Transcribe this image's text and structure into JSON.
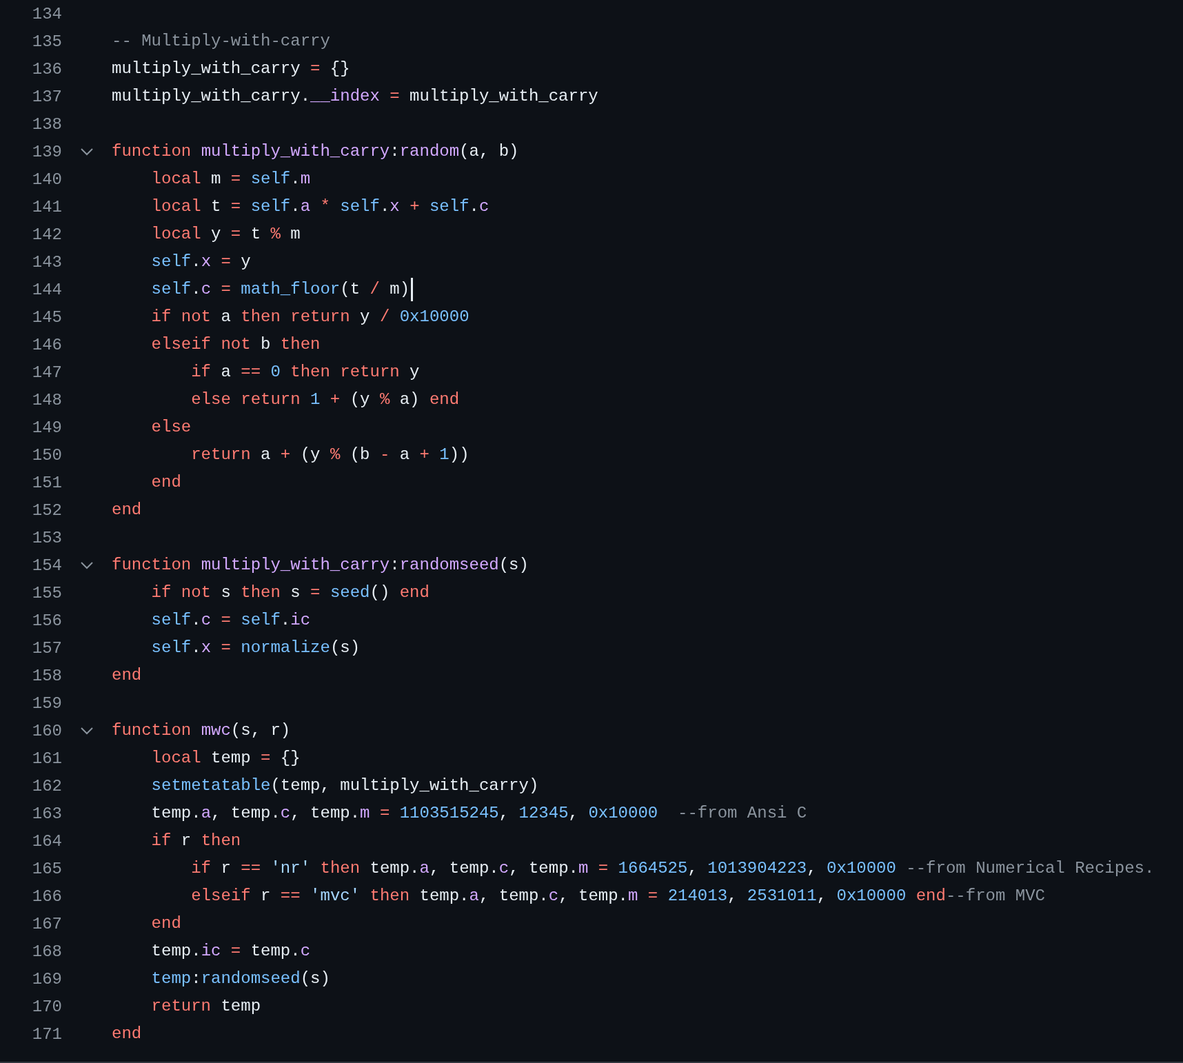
{
  "lines": [
    {
      "number": "134"
    },
    {
      "number": "135",
      "tokens": [
        {
          "text": "-- Multiply-with-carry",
          "kind": "comment"
        }
      ]
    },
    {
      "number": "136",
      "tokens": [
        {
          "text": "multiply_with_carry ",
          "kind": "plain"
        },
        {
          "text": "=",
          "kind": "keyword"
        },
        {
          "text": " {}",
          "kind": "plain"
        }
      ]
    },
    {
      "number": "137",
      "tokens": [
        {
          "text": "multiply_with_carry.",
          "kind": "plain"
        },
        {
          "text": "__index ",
          "kind": "func"
        },
        {
          "text": "=",
          "kind": "keyword"
        },
        {
          "text": " multiply_with_carry",
          "kind": "plain"
        }
      ]
    },
    {
      "number": "138"
    },
    {
      "number": "139",
      "expanded": true,
      "tokens": [
        {
          "text": "function ",
          "kind": "keyword"
        },
        {
          "text": "multiply_with_carry",
          "kind": "func"
        },
        {
          "text": ":",
          "kind": "plain"
        },
        {
          "text": "random",
          "kind": "func"
        },
        {
          "text": "(a, b)",
          "kind": "plain"
        }
      ]
    },
    {
      "number": "140",
      "tokens": [
        {
          "text": "    local",
          "kind": "keyword"
        },
        {
          "text": " m ",
          "kind": "plain"
        },
        {
          "text": "= ",
          "kind": "keyword"
        },
        {
          "text": "self",
          "kind": "const"
        },
        {
          "text": ".",
          "kind": "plain"
        },
        {
          "text": "m",
          "kind": "func"
        }
      ]
    },
    {
      "number": "141",
      "tokens": [
        {
          "text": "    local",
          "kind": "keyword"
        },
        {
          "text": " t ",
          "kind": "plain"
        },
        {
          "text": "= ",
          "kind": "keyword"
        },
        {
          "text": "self",
          "kind": "const"
        },
        {
          "text": ".",
          "kind": "plain"
        },
        {
          "text": "a ",
          "kind": "func"
        },
        {
          "text": "* ",
          "kind": "keyword"
        },
        {
          "text": "self",
          "kind": "const"
        },
        {
          "text": ".",
          "kind": "plain"
        },
        {
          "text": "x ",
          "kind": "func"
        },
        {
          "text": "+ ",
          "kind": "keyword"
        },
        {
          "text": "self",
          "kind": "const"
        },
        {
          "text": ".",
          "kind": "plain"
        },
        {
          "text": "c",
          "kind": "func"
        }
      ]
    },
    {
      "number": "142",
      "tokens": [
        {
          "text": "    local",
          "kind": "keyword"
        },
        {
          "text": " y ",
          "kind": "plain"
        },
        {
          "text": "=",
          "kind": "keyword"
        },
        {
          "text": " t ",
          "kind": "plain"
        },
        {
          "text": "%",
          "kind": "keyword"
        },
        {
          "text": " m",
          "kind": "plain"
        }
      ]
    },
    {
      "number": "143",
      "tokens": [
        {
          "text": "    self",
          "kind": "const"
        },
        {
          "text": ".",
          "kind": "plain"
        },
        {
          "text": "x ",
          "kind": "func"
        },
        {
          "text": "=",
          "kind": "keyword"
        },
        {
          "text": " y",
          "kind": "plain"
        }
      ]
    },
    {
      "number": "144",
      "cursor": true,
      "tokens": [
        {
          "text": "    self",
          "kind": "const"
        },
        {
          "text": ".",
          "kind": "plain"
        },
        {
          "text": "c ",
          "kind": "func"
        },
        {
          "text": "= ",
          "kind": "keyword"
        },
        {
          "text": "math_floor",
          "kind": "const"
        },
        {
          "text": "(t ",
          "kind": "plain"
        },
        {
          "text": "/",
          "kind": "keyword"
        },
        {
          "text": " m)",
          "kind": "plain"
        }
      ]
    },
    {
      "number": "145",
      "tokens": [
        {
          "text": "    if not",
          "kind": "keyword"
        },
        {
          "text": " a ",
          "kind": "plain"
        },
        {
          "text": "then return",
          "kind": "keyword"
        },
        {
          "text": " y ",
          "kind": "plain"
        },
        {
          "text": "/ ",
          "kind": "keyword"
        },
        {
          "text": "0x10000",
          "kind": "const"
        }
      ]
    },
    {
      "number": "146",
      "tokens": [
        {
          "text": "    elseif not",
          "kind": "keyword"
        },
        {
          "text": " b ",
          "kind": "plain"
        },
        {
          "text": "then",
          "kind": "keyword"
        }
      ]
    },
    {
      "number": "147",
      "tokens": [
        {
          "text": "        if",
          "kind": "keyword"
        },
        {
          "text": " a ",
          "kind": "plain"
        },
        {
          "text": "== ",
          "kind": "keyword"
        },
        {
          "text": "0 ",
          "kind": "const"
        },
        {
          "text": "then return",
          "kind": "keyword"
        },
        {
          "text": " y",
          "kind": "plain"
        }
      ]
    },
    {
      "number": "148",
      "tokens": [
        {
          "text": "        else return ",
          "kind": "keyword"
        },
        {
          "text": "1 ",
          "kind": "const"
        },
        {
          "text": "+",
          "kind": "keyword"
        },
        {
          "text": " (y ",
          "kind": "plain"
        },
        {
          "text": "%",
          "kind": "keyword"
        },
        {
          "text": " a) ",
          "kind": "plain"
        },
        {
          "text": "end",
          "kind": "keyword"
        }
      ]
    },
    {
      "number": "149",
      "tokens": [
        {
          "text": "    else",
          "kind": "keyword"
        }
      ]
    },
    {
      "number": "150",
      "tokens": [
        {
          "text": "        return",
          "kind": "keyword"
        },
        {
          "text": " a ",
          "kind": "plain"
        },
        {
          "text": "+",
          "kind": "keyword"
        },
        {
          "text": " (y ",
          "kind": "plain"
        },
        {
          "text": "%",
          "kind": "keyword"
        },
        {
          "text": " (b ",
          "kind": "plain"
        },
        {
          "text": "-",
          "kind": "keyword"
        },
        {
          "text": " a ",
          "kind": "plain"
        },
        {
          "text": "+ ",
          "kind": "keyword"
        },
        {
          "text": "1",
          "kind": "const"
        },
        {
          "text": "))",
          "kind": "plain"
        }
      ]
    },
    {
      "number": "151",
      "tokens": [
        {
          "text": "    end",
          "kind": "keyword"
        }
      ]
    },
    {
      "number": "152",
      "tokens": [
        {
          "text": "end",
          "kind": "keyword"
        }
      ]
    },
    {
      "number": "153"
    },
    {
      "number": "154",
      "expanded": true,
      "tokens": [
        {
          "text": "function ",
          "kind": "keyword"
        },
        {
          "text": "multiply_with_carry",
          "kind": "func"
        },
        {
          "text": ":",
          "kind": "plain"
        },
        {
          "text": "randomseed",
          "kind": "func"
        },
        {
          "text": "(s)",
          "kind": "plain"
        }
      ]
    },
    {
      "number": "155",
      "tokens": [
        {
          "text": "    if not",
          "kind": "keyword"
        },
        {
          "text": " s ",
          "kind": "plain"
        },
        {
          "text": "then",
          "kind": "keyword"
        },
        {
          "text": " s ",
          "kind": "plain"
        },
        {
          "text": "= ",
          "kind": "keyword"
        },
        {
          "text": "seed",
          "kind": "const"
        },
        {
          "text": "() ",
          "kind": "plain"
        },
        {
          "text": "end",
          "kind": "keyword"
        }
      ]
    },
    {
      "number": "156",
      "tokens": [
        {
          "text": "    self",
          "kind": "const"
        },
        {
          "text": ".",
          "kind": "plain"
        },
        {
          "text": "c ",
          "kind": "func"
        },
        {
          "text": "= ",
          "kind": "keyword"
        },
        {
          "text": "self",
          "kind": "const"
        },
        {
          "text": ".",
          "kind": "plain"
        },
        {
          "text": "ic",
          "kind": "func"
        }
      ]
    },
    {
      "number": "157",
      "tokens": [
        {
          "text": "    self",
          "kind": "const"
        },
        {
          "text": ".",
          "kind": "plain"
        },
        {
          "text": "x ",
          "kind": "func"
        },
        {
          "text": "= ",
          "kind": "keyword"
        },
        {
          "text": "normalize",
          "kind": "const"
        },
        {
          "text": "(s)",
          "kind": "plain"
        }
      ]
    },
    {
      "number": "158",
      "tokens": [
        {
          "text": "end",
          "kind": "keyword"
        }
      ]
    },
    {
      "number": "159"
    },
    {
      "number": "160",
      "expanded": true,
      "tokens": [
        {
          "text": "function ",
          "kind": "keyword"
        },
        {
          "text": "mwc",
          "kind": "func"
        },
        {
          "text": "(s, r)",
          "kind": "plain"
        }
      ]
    },
    {
      "number": "161",
      "tokens": [
        {
          "text": "    local",
          "kind": "keyword"
        },
        {
          "text": " temp ",
          "kind": "plain"
        },
        {
          "text": "=",
          "kind": "keyword"
        },
        {
          "text": " {}",
          "kind": "plain"
        }
      ]
    },
    {
      "number": "162",
      "tokens": [
        {
          "text": "    setmetatable",
          "kind": "const"
        },
        {
          "text": "(temp, multiply_with_carry)",
          "kind": "plain"
        }
      ]
    },
    {
      "number": "163",
      "tokens": [
        {
          "text": "    temp.",
          "kind": "plain"
        },
        {
          "text": "a",
          "kind": "func"
        },
        {
          "text": ", temp.",
          "kind": "plain"
        },
        {
          "text": "c",
          "kind": "func"
        },
        {
          "text": ", temp.",
          "kind": "plain"
        },
        {
          "text": "m ",
          "kind": "func"
        },
        {
          "text": "= ",
          "kind": "keyword"
        },
        {
          "text": "1103515245",
          "kind": "const"
        },
        {
          "text": ", ",
          "kind": "plain"
        },
        {
          "text": "12345",
          "kind": "const"
        },
        {
          "text": ", ",
          "kind": "plain"
        },
        {
          "text": "0x10000  ",
          "kind": "const"
        },
        {
          "text": "--from Ansi C",
          "kind": "comment"
        }
      ]
    },
    {
      "number": "164",
      "tokens": [
        {
          "text": "    if",
          "kind": "keyword"
        },
        {
          "text": " r ",
          "kind": "plain"
        },
        {
          "text": "then",
          "kind": "keyword"
        }
      ]
    },
    {
      "number": "165",
      "tokens": [
        {
          "text": "        if",
          "kind": "keyword"
        },
        {
          "text": " r ",
          "kind": "plain"
        },
        {
          "text": "== ",
          "kind": "keyword"
        },
        {
          "text": "'nr' ",
          "kind": "string"
        },
        {
          "text": "then",
          "kind": "keyword"
        },
        {
          "text": " temp.",
          "kind": "plain"
        },
        {
          "text": "a",
          "kind": "func"
        },
        {
          "text": ", temp.",
          "kind": "plain"
        },
        {
          "text": "c",
          "kind": "func"
        },
        {
          "text": ", temp.",
          "kind": "plain"
        },
        {
          "text": "m ",
          "kind": "func"
        },
        {
          "text": "= ",
          "kind": "keyword"
        },
        {
          "text": "1664525",
          "kind": "const"
        },
        {
          "text": ", ",
          "kind": "plain"
        },
        {
          "text": "1013904223",
          "kind": "const"
        },
        {
          "text": ", ",
          "kind": "plain"
        },
        {
          "text": "0x10000 ",
          "kind": "const"
        },
        {
          "text": "--from Numerical Recipes.",
          "kind": "comment"
        }
      ]
    },
    {
      "number": "166",
      "tokens": [
        {
          "text": "        elseif",
          "kind": "keyword"
        },
        {
          "text": " r ",
          "kind": "plain"
        },
        {
          "text": "== ",
          "kind": "keyword"
        },
        {
          "text": "'mvc' ",
          "kind": "string"
        },
        {
          "text": "then",
          "kind": "keyword"
        },
        {
          "text": " temp.",
          "kind": "plain"
        },
        {
          "text": "a",
          "kind": "func"
        },
        {
          "text": ", temp.",
          "kind": "plain"
        },
        {
          "text": "c",
          "kind": "func"
        },
        {
          "text": ", temp.",
          "kind": "plain"
        },
        {
          "text": "m ",
          "kind": "func"
        },
        {
          "text": "= ",
          "kind": "keyword"
        },
        {
          "text": "214013",
          "kind": "const"
        },
        {
          "text": ", ",
          "kind": "plain"
        },
        {
          "text": "2531011",
          "kind": "const"
        },
        {
          "text": ", ",
          "kind": "plain"
        },
        {
          "text": "0x10000 ",
          "kind": "const"
        },
        {
          "text": "end",
          "kind": "keyword"
        },
        {
          "text": "--from MVC",
          "kind": "comment"
        }
      ]
    },
    {
      "number": "167",
      "tokens": [
        {
          "text": "    end",
          "kind": "keyword"
        }
      ]
    },
    {
      "number": "168",
      "tokens": [
        {
          "text": "    temp.",
          "kind": "plain"
        },
        {
          "text": "ic ",
          "kind": "func"
        },
        {
          "text": "=",
          "kind": "keyword"
        },
        {
          "text": " temp.",
          "kind": "plain"
        },
        {
          "text": "c",
          "kind": "func"
        }
      ]
    },
    {
      "number": "169",
      "tokens": [
        {
          "text": "    temp",
          "kind": "const"
        },
        {
          "text": ":",
          "kind": "plain"
        },
        {
          "text": "randomseed",
          "kind": "const"
        },
        {
          "text": "(s)",
          "kind": "plain"
        }
      ]
    },
    {
      "number": "170",
      "tokens": [
        {
          "text": "    return",
          "kind": "keyword"
        },
        {
          "text": " temp",
          "kind": "plain"
        }
      ]
    },
    {
      "number": "171",
      "tokens": [
        {
          "text": "end",
          "kind": "keyword"
        }
      ]
    }
  ]
}
